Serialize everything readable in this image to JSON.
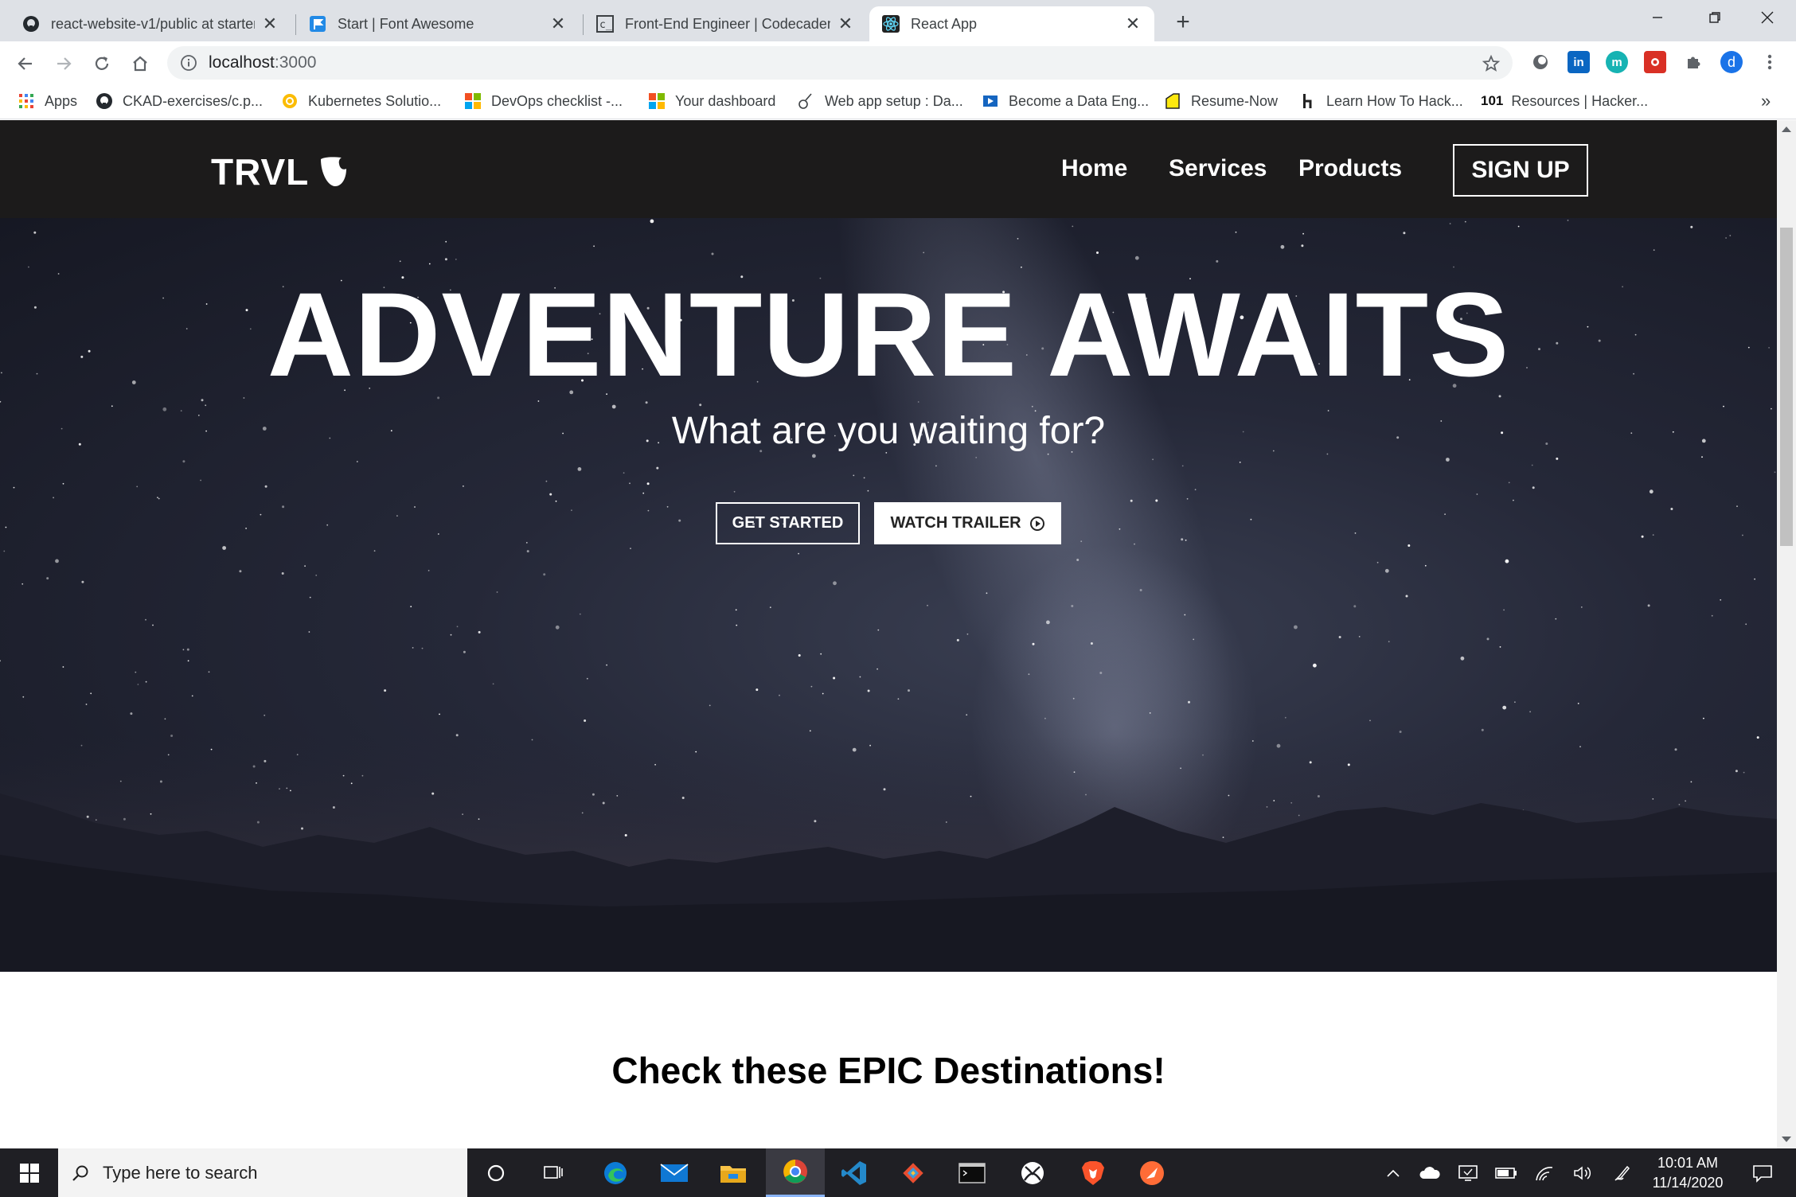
{
  "browser": {
    "tabs": [
      {
        "label": "react-website-v1/public at starter",
        "icon": "github-icon"
      },
      {
        "label": "Start | Font Awesome",
        "icon": "font-awesome-flag-icon"
      },
      {
        "label": "Front-End Engineer | Codecademy",
        "icon": "codecademy-icon"
      },
      {
        "label": "React App",
        "icon": "react-icon"
      }
    ],
    "close_glyph": "✕",
    "newtab_glyph": "+",
    "url_host": "localhost",
    "url_port": ":3000",
    "bookmarks": [
      {
        "label": "Apps",
        "icon": "apps-grid-icon"
      },
      {
        "label": "CKAD-exercises/c.p...",
        "icon": "github-icon"
      },
      {
        "label": "Kubernetes Solutio...",
        "icon": "kubernetes-icon"
      },
      {
        "label": "DevOps checklist -...",
        "icon": "microsoft-icon"
      },
      {
        "label": "Your dashboard",
        "icon": "microsoft-icon"
      },
      {
        "label": "Web app setup : Da...",
        "icon": "guitar-icon"
      },
      {
        "label": "Become a Data Eng...",
        "icon": "play-icon"
      },
      {
        "label": "Resume-Now",
        "icon": "resume-icon"
      },
      {
        "label": "Learn How To Hack...",
        "icon": "hackerone-icon"
      },
      {
        "label": "Resources | Hacker...",
        "icon": "hacker101-icon",
        "prefix": "101"
      }
    ],
    "bookmarks_overflow": "»",
    "profile_initial": "d"
  },
  "site": {
    "logo_text": "TRVL",
    "nav": {
      "home": "Home",
      "services": "Services",
      "products": "Products",
      "signup": "SIGN UP"
    },
    "hero": {
      "title": "ADVENTURE AWAITS",
      "subtitle": "What are you waiting for?",
      "get_started": "GET STARTED",
      "watch_trailer": "WATCH TRAILER"
    },
    "section_title": "Check these EPIC Destinations!"
  },
  "taskbar": {
    "search_placeholder": "Type here to search",
    "time": "10:01 AM",
    "date": "11/14/2020"
  },
  "colors": {
    "navbar": "#1c1b1b",
    "hero_sky": "#252838",
    "accent_active": "#8ab4f8"
  }
}
